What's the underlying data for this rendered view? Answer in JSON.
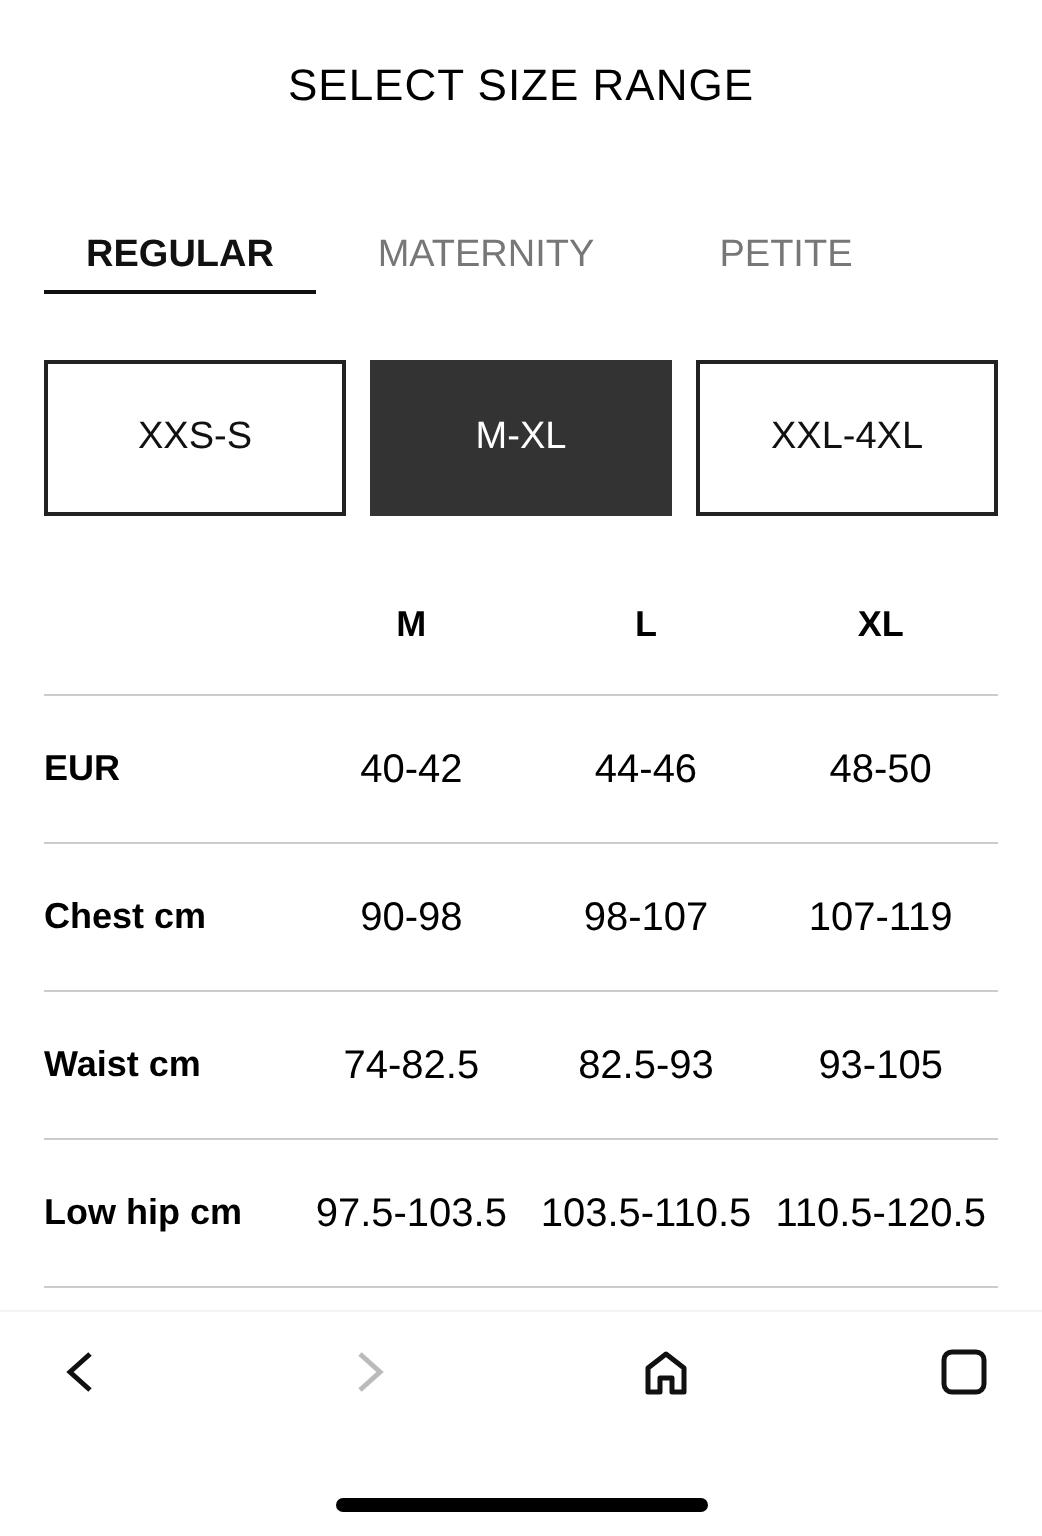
{
  "title": "SELECT SIZE RANGE",
  "tabs": [
    {
      "label": "REGULAR",
      "selected": true
    },
    {
      "label": "MATERNITY",
      "selected": false
    },
    {
      "label": "PETITE",
      "selected": false
    }
  ],
  "size_ranges": [
    {
      "label": "XXS-S",
      "selected": false
    },
    {
      "label": "M-XL",
      "selected": true
    },
    {
      "label": "XXL-4XL",
      "selected": false
    }
  ],
  "table": {
    "columns": [
      "M",
      "L",
      "XL"
    ],
    "rows": [
      {
        "label": "EUR",
        "values": [
          "40-42",
          "44-46",
          "48-50"
        ]
      },
      {
        "label": "Chest cm",
        "values": [
          "90-98",
          "98-107",
          "107-119"
        ]
      },
      {
        "label": "Waist cm",
        "values": [
          "74-82.5",
          "82.5-93",
          "93-105"
        ]
      },
      {
        "label": "Low hip cm",
        "values": [
          "97.5-103.5",
          "103.5-110.5",
          "110.5-120.5"
        ]
      }
    ]
  },
  "toolbar": [
    {
      "kind": "back",
      "disabled": false
    },
    {
      "kind": "forward",
      "disabled": true
    },
    {
      "kind": "home",
      "disabled": false
    },
    {
      "kind": "tabs",
      "disabled": false
    }
  ]
}
